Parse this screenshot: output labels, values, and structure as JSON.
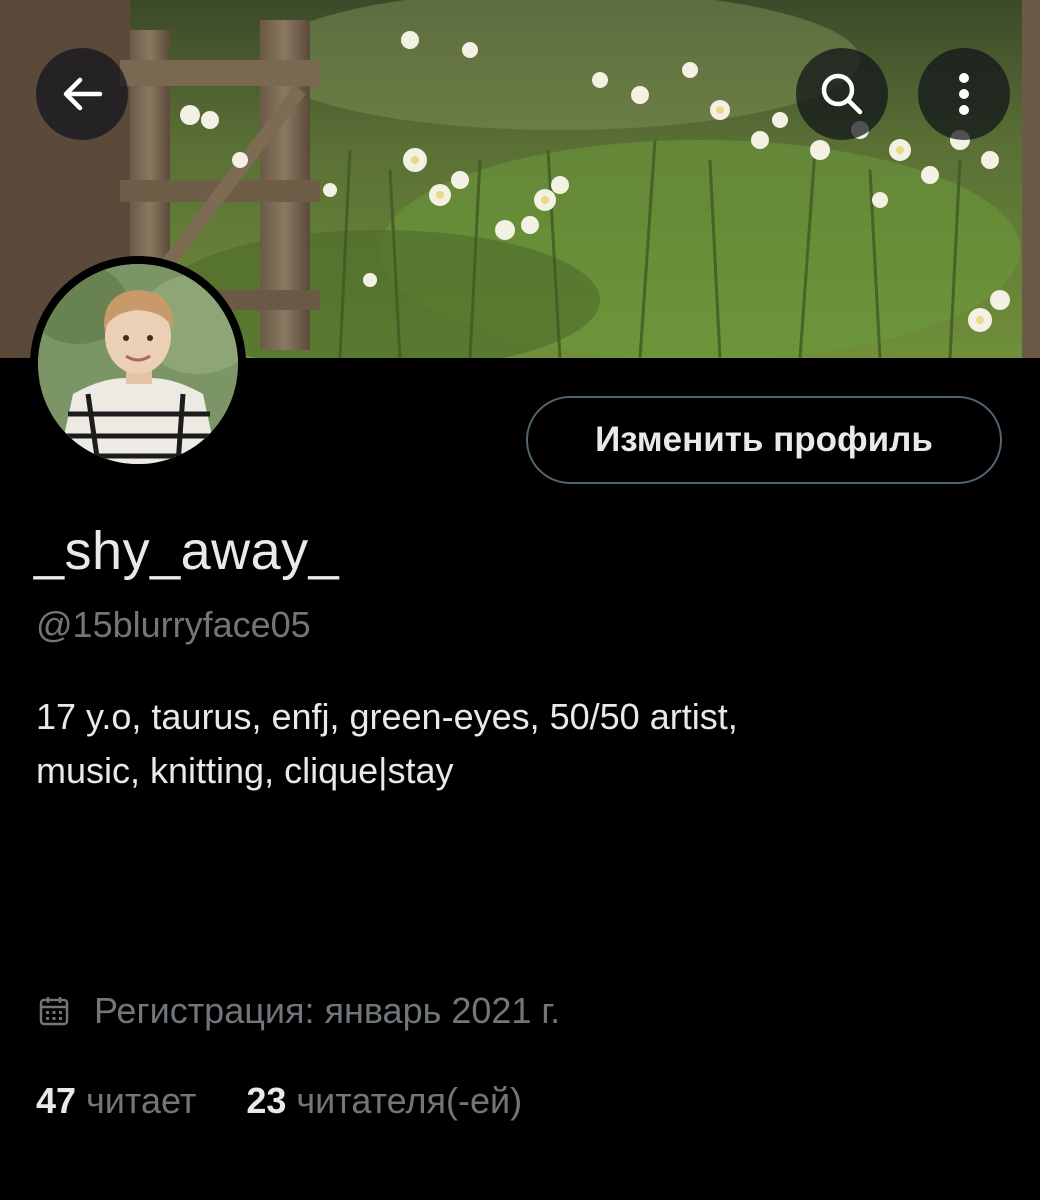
{
  "header": {
    "back_icon": "arrow-left-icon",
    "search_icon": "search-icon",
    "more_icon": "more-vertical-icon"
  },
  "profile": {
    "edit_button_label": "Изменить профиль",
    "display_name": "_shy_away_",
    "handle": "@15blurryface05",
    "bio_line_1": "17 y.o, taurus, enfj, green-eyes, 50/50 artist,",
    "bio_line_2": "music, knitting, clique|stay",
    "joined_icon": "calendar-icon",
    "joined_text": "Регистрация: январь 2021 г.",
    "following_count": "47",
    "following_label": "читает",
    "followers_count": "23",
    "followers_label": "читателя(-ей)"
  },
  "colors": {
    "background": "#000000",
    "primary_text": "#e7e9ea",
    "secondary_text": "#71767b",
    "button_border": "#536471"
  }
}
